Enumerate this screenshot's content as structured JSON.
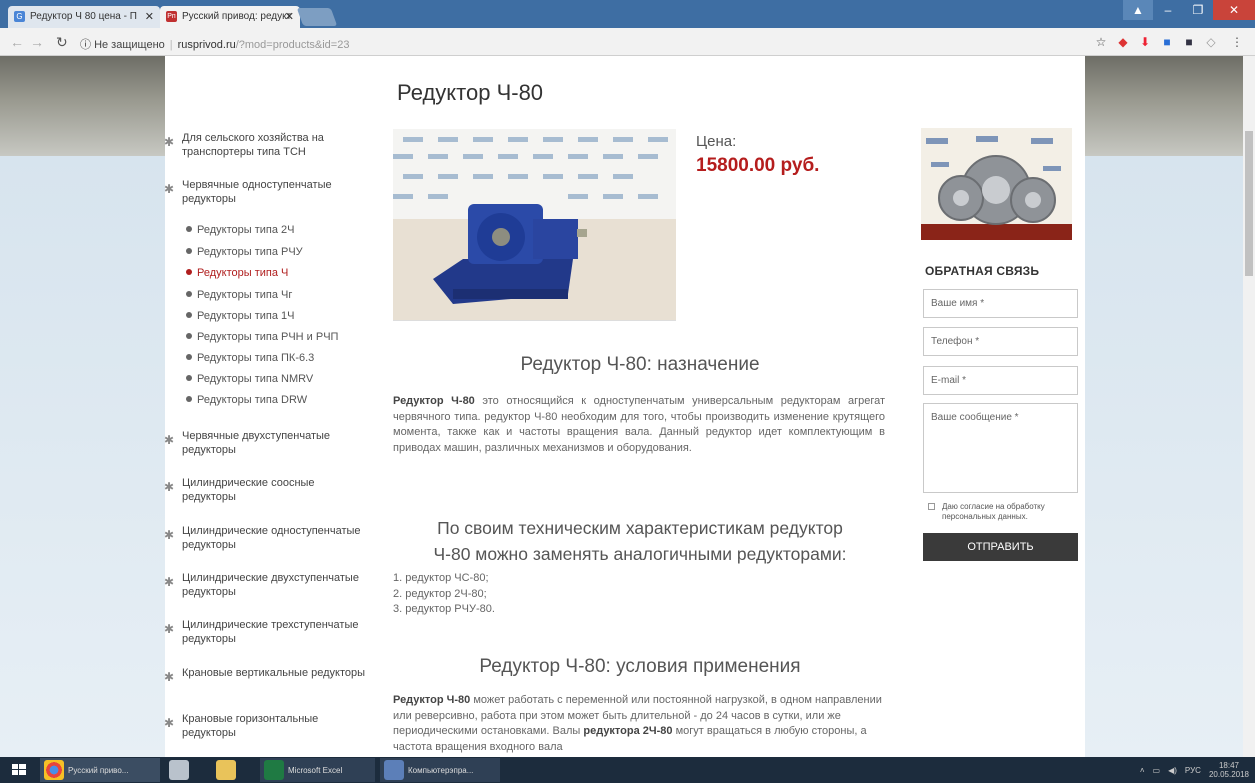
{
  "browser": {
    "tabs": [
      {
        "label": "Редуктор Ч 80 цена - П",
        "favicon": "G"
      },
      {
        "label": "Русский привод: редукт",
        "favicon": "Рп"
      }
    ],
    "address": {
      "insecure_label": "Не защищено",
      "domain": "rusprivod.ru",
      "path": "/?mod=products&id=23"
    }
  },
  "sidebar": {
    "categories": [
      {
        "label": "Для сельского хозяйства на транспортеры типа ТСН"
      },
      {
        "label": "Червячные одноступенчатые редукторы"
      },
      {
        "label": "Червячные двухступенчатые редукторы"
      },
      {
        "label": "Цилиндрические соосные редукторы"
      },
      {
        "label": "Цилиндрические одноступенчатые редукторы"
      },
      {
        "label": "Цилиндрические двухступенчатые редукторы"
      },
      {
        "label": "Цилиндрические трехступенчатые редукторы"
      },
      {
        "label": "Крановые вертикальные редукторы"
      },
      {
        "label": "Крановые горизонтальные редукторы"
      }
    ],
    "subitems": [
      {
        "label": "Редукторы типа 2Ч"
      },
      {
        "label": "Редукторы типа РЧУ"
      },
      {
        "label": "Редукторы типа Ч"
      },
      {
        "label": "Редукторы типа Чг"
      },
      {
        "label": "Редукторы типа 1Ч"
      },
      {
        "label": "Редукторы типа РЧН и РЧП"
      },
      {
        "label": "Редукторы типа ПК-6.3"
      },
      {
        "label": "Редукторы типа NMRV"
      },
      {
        "label": "Редукторы типа DRW"
      }
    ]
  },
  "main": {
    "title": "Редуктор Ч-80",
    "price_label": "Цена:",
    "price": "15800.00 руб.",
    "section1": {
      "heading": "Редуктор Ч-80: назначение",
      "lead": "Редуктор Ч-80",
      "text": " это относящийся к одноступенчатым универсальным редукторам агрегат червячного типа. редуктор Ч-80 необходим для того, чтобы производить изменение крутящего момента, также как и частоты вращения вала. Данный редуктор идет комплектующим в приводах машин, различных механизмов и оборудования."
    },
    "section2": {
      "heading_line1": "По своим техническим характеристикам редуктор",
      "heading_line2": "Ч-80 можно заменять аналогичными редукторами:",
      "items": [
        "1. редуктор ЧС-80;",
        "2. редуктор 2Ч-80;",
        "3. редуктор РЧУ-80."
      ]
    },
    "section3": {
      "heading": "Редуктор Ч-80: условия применения",
      "lead": "Редуктор Ч-80",
      "text1": " может работать с переменной или постоянной нагрузкой, в одном направлении или реверсивно, работа при этом может быть длительной - до 24 часов в сутки, или же периодическими остановками. Валы ",
      "lead2": "редуктора 2Ч-80",
      "text2": " могут вращаться в любую стороны, а частота вращения входного вала"
    }
  },
  "feedback": {
    "title": "ОБРАТНАЯ СВЯЗЬ",
    "name_placeholder": "Ваше имя *",
    "phone_placeholder": "Телефон *",
    "email_placeholder": "E-mail *",
    "message_placeholder": "Ваше сообщение *",
    "consent": "Даю согласие на обработку персональных данных.",
    "submit": "ОТПРАВИТЬ"
  },
  "taskbar": {
    "items": [
      {
        "label": "Русский приво..."
      },
      {
        "label": ""
      },
      {
        "label": ""
      },
      {
        "label": "Microsoft Excel"
      },
      {
        "label": "Компьютерэпра..."
      }
    ],
    "lang": "РУС",
    "time": "18:47",
    "date": "20.05.2018"
  },
  "colors": {
    "accent_red": "#b51d1d",
    "button_dark": "#3a3a3a",
    "tabbar": "#3e6ea3"
  }
}
